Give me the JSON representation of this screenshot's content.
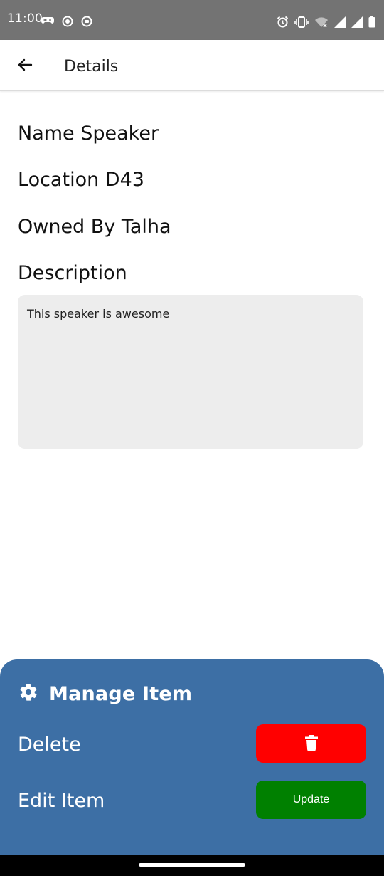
{
  "status_bar": {
    "time": "11:00",
    "left_icons": [
      "game-controller-icon",
      "target-icon",
      "record-icon"
    ],
    "right_icons": [
      "alarm-icon",
      "vibrate-icon",
      "wifi-off-icon",
      "signal-icon",
      "signal-icon",
      "battery-icon"
    ]
  },
  "app_bar": {
    "title": "Details",
    "back_icon": "arrow-left-icon"
  },
  "details": {
    "name": "Name Speaker",
    "location": "Location D43",
    "owner": "Owned By Talha",
    "description_label": "Description",
    "description_text": "This speaker is awesome"
  },
  "manage": {
    "title": "Manage Item",
    "title_icon": "gear-icon",
    "delete_label": "Delete",
    "delete_button_icon": "trash-icon",
    "edit_label": "Edit Item",
    "update_button_label": "Update"
  },
  "colors": {
    "status_bar": "#737373",
    "sheet": "#3d6fa5",
    "delete": "#ff0000",
    "update": "#008000",
    "description_box": "#ededed"
  }
}
